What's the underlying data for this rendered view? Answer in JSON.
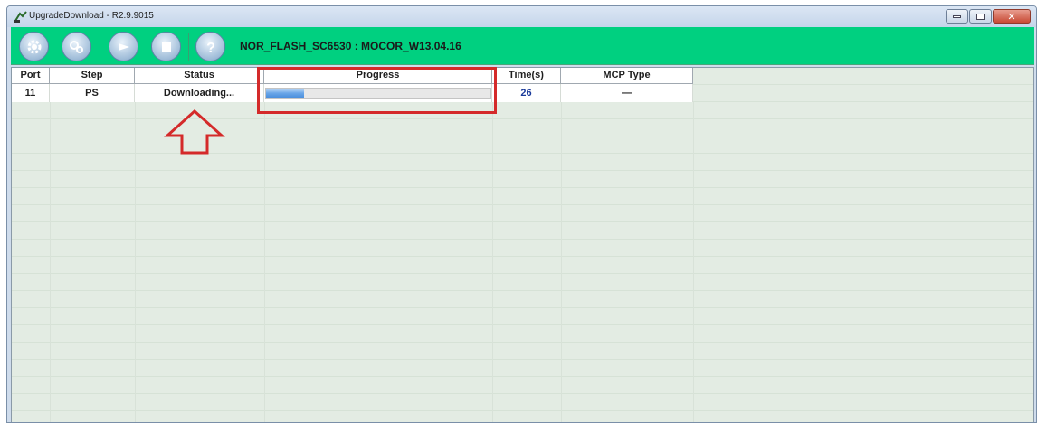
{
  "window": {
    "title": "UpgradeDownload - R2.9.9015"
  },
  "toolbar": {
    "label": "NOR_FLASH_SC6530 : MOCOR_W13.04.16",
    "buttons": [
      {
        "icon": "gear-icon"
      },
      {
        "icon": "gears-icon"
      },
      {
        "icon": "play-icon"
      },
      {
        "icon": "stop-icon"
      },
      {
        "icon": "help-icon"
      }
    ]
  },
  "table": {
    "columns": [
      "Port",
      "Step",
      "Status",
      "Progress",
      "Time(s)",
      "MCP Type"
    ],
    "rows": [
      {
        "port": "11",
        "step": "PS",
        "status": "Downloading...",
        "progress": 0.17,
        "time": "26",
        "mcp_type": "—"
      }
    ]
  },
  "colors": {
    "toolbar_green": "#00d080",
    "annotation_red": "#d42a2a"
  }
}
